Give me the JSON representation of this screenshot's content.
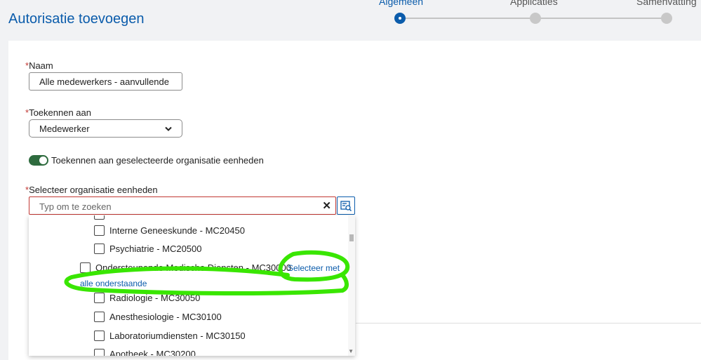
{
  "page_title": "Autorisatie toevoegen",
  "steps": [
    {
      "label": "Algemeen",
      "active": true
    },
    {
      "label": "Applicaties",
      "active": false
    },
    {
      "label": "Samenvatting",
      "active": false
    }
  ],
  "form": {
    "required_mark": "*",
    "name_label": "Naam",
    "name_value": "Alle medewerkers - aanvullende rec",
    "assign_label": "Toekennen aan",
    "assign_value": "Medewerker",
    "toggle_label": "Toekennen aan geselecteerde organisatie eenheden",
    "toggle_on": true,
    "org_label": "Selecteer organisatie eenheden",
    "org_placeholder": "Typ om te zoeken"
  },
  "tree_items": [
    {
      "label": "Interne Geneeskunde - MC20450",
      "checked": false
    },
    {
      "label": "Psychiatrie - MC20500",
      "checked": false
    },
    {
      "label": "Ondersteunende Medische Diensten - MC30000",
      "checked": false
    },
    {
      "label": "Radiologie - MC30050",
      "checked": false
    },
    {
      "label": "Anesthesiologie - MC30100",
      "checked": false
    },
    {
      "label": "Laboratoriumdiensten - MC30150",
      "checked": false
    },
    {
      "label": "Apotheek - MC30200",
      "checked": false
    }
  ],
  "select_all_link": {
    "line1": "Selecteer met",
    "line2": "alle onderstaande"
  },
  "colors": {
    "accent": "#0b5cab",
    "error": "#c23934",
    "toggle": "#2e6b3e",
    "highlight": "#39e600"
  },
  "icons": {
    "clear": "close-icon",
    "search_browse": "list-search-icon",
    "chevron": "chevron-down-icon"
  }
}
